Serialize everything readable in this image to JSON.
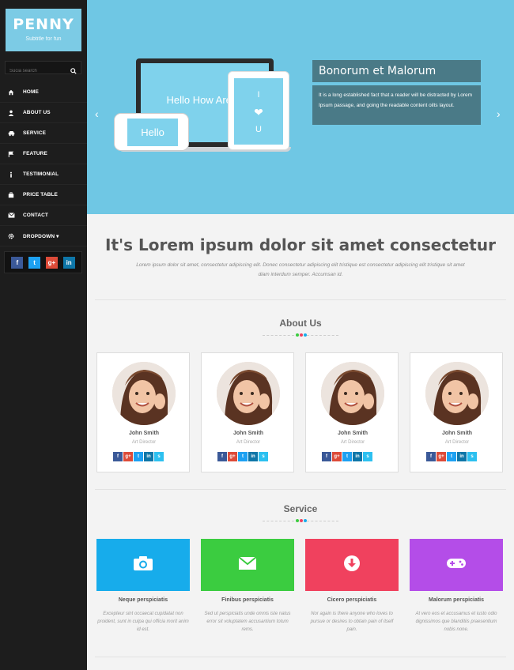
{
  "brand": {
    "title": "PENNY",
    "subtitle": "Subtitle for fun"
  },
  "search": {
    "placeholder": "Sucia search"
  },
  "nav": [
    {
      "label": "HOME",
      "icon": "home-icon"
    },
    {
      "label": "ABOUT US",
      "icon": "user-icon"
    },
    {
      "label": "SERVICE",
      "icon": "car-icon"
    },
    {
      "label": "FEATURE",
      "icon": "flag-icon"
    },
    {
      "label": "TESTIMONIAL",
      "icon": "info-icon"
    },
    {
      "label": "PRICE TABLE",
      "icon": "briefcase-icon"
    },
    {
      "label": "CONTACT",
      "icon": "envelope-icon"
    },
    {
      "label": "DROPDOWN ▾",
      "icon": "gear-icon"
    }
  ],
  "sidebar_social": [
    {
      "label": "f",
      "name": "facebook",
      "color": "#3b5998"
    },
    {
      "label": "t",
      "name": "twitter",
      "color": "#1da1f2"
    },
    {
      "label": "g+",
      "name": "google-plus",
      "color": "#dd4b39"
    },
    {
      "label": "in",
      "name": "linkedin",
      "color": "#0e76a8"
    }
  ],
  "hero": {
    "arrow_left": "‹",
    "arrow_right": "›",
    "laptop_text": "Hello How Are You?",
    "tablet_lines": [
      "I",
      "❤",
      "U"
    ],
    "phone_text": "Hello",
    "slide_title": "Bonorum et Malorum",
    "slide_text": "It is a long established fact that a reader will be distracted by Lorem Ipsum passage, and going the readable content oilts layout."
  },
  "intro": {
    "heading": "It's Lorem ipsum dolor sit amet consectetur",
    "text": "Lorem ipsum dolor sit amet, consectetur adipiscing elit. Donec consectetur adipiscing elit tristique est consectetur adipiscing elit tristique sit amet diam interdum semper. Accumsan id."
  },
  "about": {
    "title": "About Us",
    "members": [
      {
        "name": "John Smith",
        "role": "Art Director"
      },
      {
        "name": "John Smith",
        "role": "Art Director"
      },
      {
        "name": "John Smith",
        "role": "Art Director"
      },
      {
        "name": "John Smith",
        "role": "Art Director"
      }
    ],
    "social": [
      {
        "label": "f",
        "color": "#3b5998"
      },
      {
        "label": "g+",
        "color": "#dd4b39"
      },
      {
        "label": "t",
        "color": "#1da1f2"
      },
      {
        "label": "in",
        "color": "#0e76a8"
      },
      {
        "label": "s",
        "color": "#2dc0f0"
      }
    ]
  },
  "service": {
    "title": "Service",
    "items": [
      {
        "title": "Neque perspiciatis",
        "text": "Excepteur sint occaecat cupidatat non proident, sunt in culpa qui officia morit anim id est.",
        "color": "#17aceb",
        "icon": "camera-icon"
      },
      {
        "title": "Finibus perspiciatis",
        "text": "Sed ut perspiciatis unde omnis iste natus error sit voluptatem accusantium totum rems.",
        "color": "#3bcc40",
        "icon": "envelope-icon"
      },
      {
        "title": "Cicero perspiciatis",
        "text": "Nor again is there anyone who loves to pursue or desires to obtain pain of itself pain.",
        "color": "#f0415e",
        "icon": "download-icon"
      },
      {
        "title": "Malorum perspiciatis",
        "text": "At vero eos et accusamus et iusto odio dignissimos que blanditiis praesentium nobis none.",
        "color": "#b44de8",
        "icon": "gamepad-icon"
      }
    ]
  },
  "colors": {
    "sidebar_bg": "#1d1d1d",
    "hero_bg": "#6fc7e4",
    "logo_bg": "#7ccbe5",
    "slide_box": "#4a7a87",
    "separator_dots": [
      "#3bcc40",
      "#f0415e",
      "#17aceb",
      "#b44de8"
    ]
  }
}
